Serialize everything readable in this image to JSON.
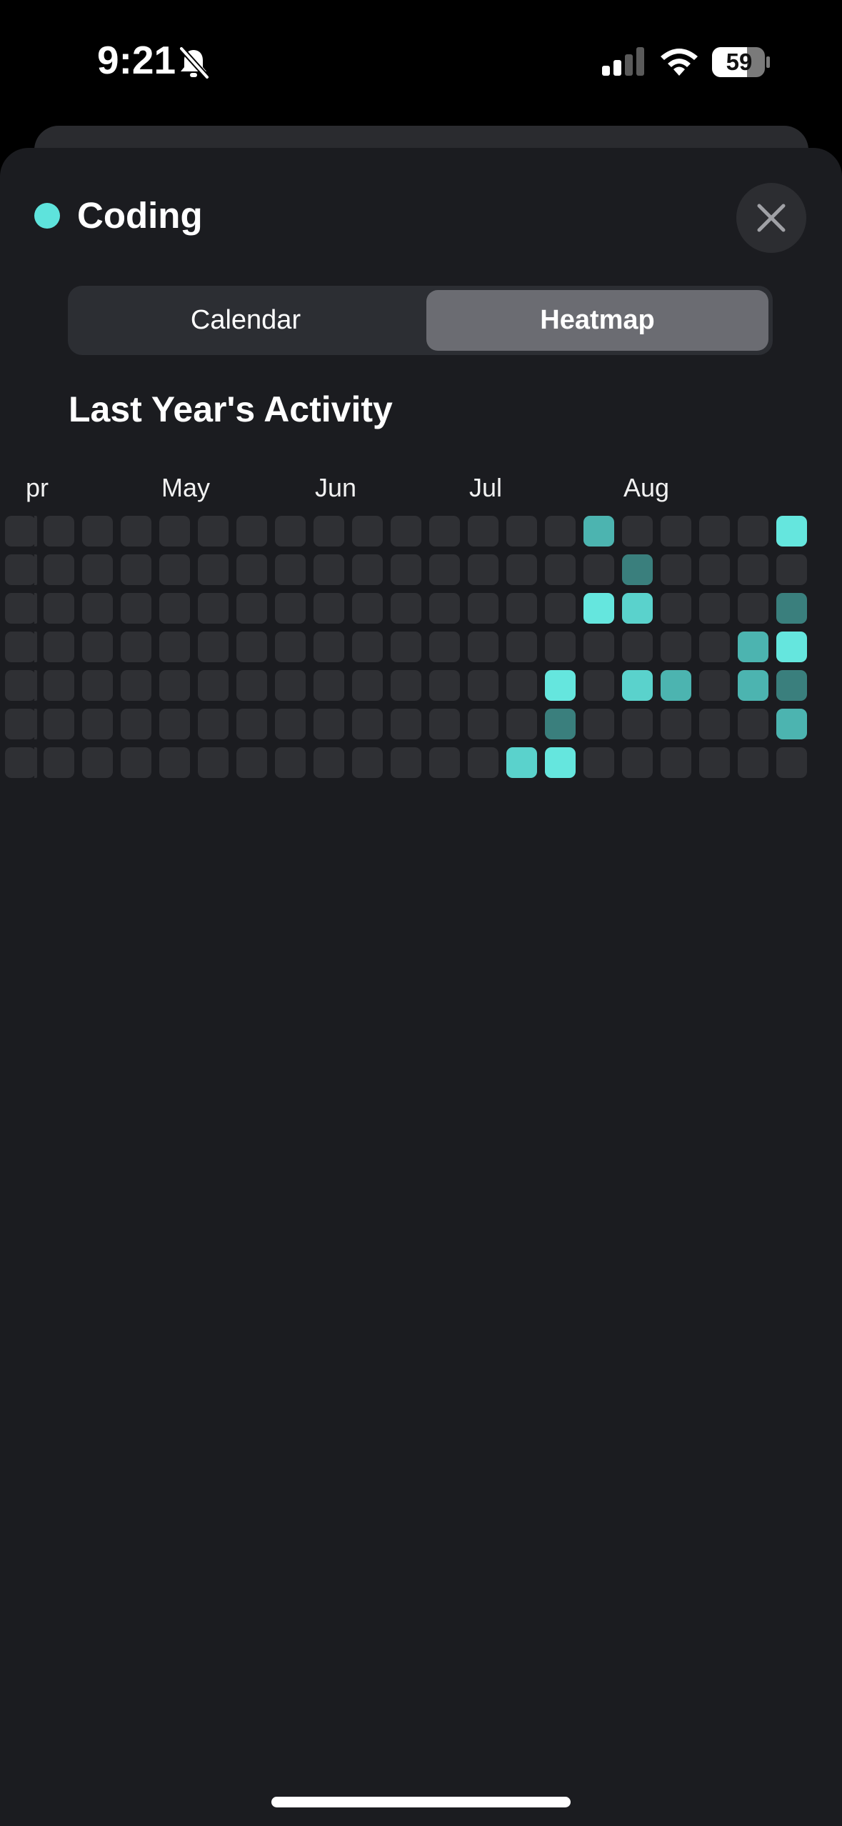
{
  "status_bar": {
    "time": "9:21",
    "battery": "59",
    "bell_icon": "bell-slash-icon",
    "signal_icon": "cellular-signal-icon",
    "wifi_icon": "wifi-icon"
  },
  "header": {
    "title": "Coding",
    "accent": "#5ee3dc",
    "close_icon": "close-icon"
  },
  "segmented": {
    "options": [
      "Calendar",
      "Heatmap"
    ],
    "selected": "Heatmap"
  },
  "section_title": "Last Year's Activity",
  "chart_data": {
    "type": "heatmap",
    "month_labels": [
      "pr",
      "May",
      "Jun",
      "Jul",
      "Aug"
    ],
    "rows": 7,
    "columns": 21,
    "colors": {
      "0": "#2f3034",
      "1": "#3a7f7d",
      "2": "#4cb4b0",
      "3": "#5ad2cc",
      "4": "#65e6de"
    },
    "values": [
      [
        0,
        0,
        0,
        0,
        0,
        0,
        0,
        0,
        0,
        0,
        0,
        0,
        0,
        0,
        0,
        2,
        0,
        0,
        0,
        0,
        4
      ],
      [
        0,
        0,
        0,
        0,
        0,
        0,
        0,
        0,
        0,
        0,
        0,
        0,
        0,
        0,
        0,
        0,
        1,
        0,
        0,
        0,
        0
      ],
      [
        0,
        0,
        0,
        0,
        0,
        0,
        0,
        0,
        0,
        0,
        0,
        0,
        0,
        0,
        0,
        4,
        3,
        0,
        0,
        0,
        1
      ],
      [
        0,
        0,
        0,
        0,
        0,
        0,
        0,
        0,
        0,
        0,
        0,
        0,
        0,
        0,
        0,
        0,
        0,
        0,
        0,
        2,
        4
      ],
      [
        0,
        0,
        0,
        0,
        0,
        0,
        0,
        0,
        0,
        0,
        0,
        0,
        0,
        0,
        4,
        0,
        3,
        2,
        0,
        2,
        1
      ],
      [
        0,
        0,
        0,
        0,
        0,
        0,
        0,
        0,
        0,
        0,
        0,
        0,
        0,
        0,
        1,
        0,
        0,
        0,
        0,
        0,
        2
      ],
      [
        0,
        0,
        0,
        0,
        0,
        0,
        0,
        0,
        0,
        0,
        0,
        0,
        0,
        3,
        4,
        0,
        0,
        0,
        0,
        0,
        0
      ]
    ]
  }
}
